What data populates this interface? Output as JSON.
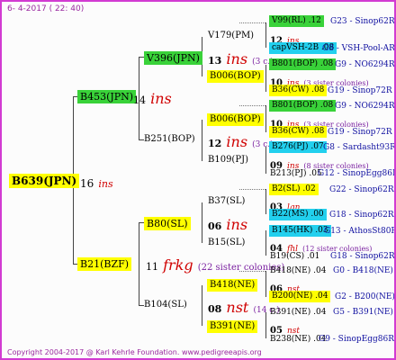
{
  "header": {
    "date": "6- 4-2017 ( 22: 40)"
  },
  "footer": {
    "copyright": "Copyright 2004-2017 @ Karl Kehrle Foundation.",
    "url": "www.pedigreeapis.org"
  },
  "g1": {
    "id": "B639(JPN)",
    "num": "16",
    "species": "ins"
  },
  "g2": [
    {
      "id": "B453(JPN)",
      "num": "14",
      "species": "ins"
    },
    {
      "id": "B21(BZF)",
      "num": "11",
      "species": "frkg",
      "note": "(22 sister colonies)"
    }
  ],
  "g3": [
    {
      "id": "V396(JPN)",
      "num": "13",
      "species": "ins",
      "note": "(3 c.)"
    },
    {
      "id": "B251(BOP)",
      "num": "12",
      "species": "ins",
      "note": "(3 c.)"
    },
    {
      "id": "B80(SL)",
      "num": "06",
      "species": "ins"
    },
    {
      "id": "B104(SL)",
      "num": "08",
      "species": "nst",
      "note": "(14 c.)"
    }
  ],
  "g4": [
    {
      "id": "V179(PM)",
      "num": "12",
      "species": "ins"
    },
    {
      "id": "B006(BOP)",
      "num": "10",
      "species": "ins",
      "note": "(3 sister colonies)"
    },
    {
      "id": "B006(BOP)",
      "num": "10",
      "species": "ins",
      "note": "(3 sister colonies)"
    },
    {
      "id": "B109(PJ)",
      "num": "09",
      "species": "ins",
      "note": "(8 sister colonies)"
    },
    {
      "id": "B37(SL)",
      "num": "03",
      "species": "lgn"
    },
    {
      "id": "B15(SL)",
      "num": "04",
      "species": "fhl",
      "note": "(12 sister colonies)"
    },
    {
      "id": "B418(NE)",
      "num": "06",
      "species": "nst"
    },
    {
      "id": "B391(NE)",
      "num": "05",
      "species": "nst"
    }
  ],
  "g5": [
    {
      "id": "V99(RL) .12",
      "code": "G23 - Sinop62R"
    },
    {
      "id": "capVSH-2B .08",
      "code": "G8 - VSH-Pool-AR"
    },
    {
      "id": "B801(BOP) .08",
      "code": "G9 - NO6294R"
    },
    {
      "id": "B36(CW) .08",
      "code": "G19 - Sinop72R"
    },
    {
      "id": "B801(BOP) .08",
      "code": "G9 - NO6294R"
    },
    {
      "id": "B36(CW) .08",
      "code": "G19 - Sinop72R"
    },
    {
      "id": "B276(PJ) .07",
      "code": "G8 - Sardasht93R"
    },
    {
      "id": "B213(PJ) .05",
      "code": "G12 - SinopEgg86R"
    },
    {
      "id": "B2(SL) .02",
      "code": "G22 - Sinop62R"
    },
    {
      "id": "B22(MS) .00",
      "code": "G18 - Sinop62R"
    },
    {
      "id": "B145(HK) .03",
      "code": "G13 - AthosSt80R"
    },
    {
      "id": "B19(CS) .01",
      "code": "G18 - Sinop62R"
    },
    {
      "id": "B418(NE) .04",
      "code": "G0 - B418(NE)"
    },
    {
      "id": "B200(NE) .04",
      "code": "G2 - B200(NE)"
    },
    {
      "id": "B391(NE) .04",
      "code": "G5 - B391(NE)"
    },
    {
      "id": "B238(NE) .04",
      "code": "G9 - SinopEgg86R"
    }
  ]
}
